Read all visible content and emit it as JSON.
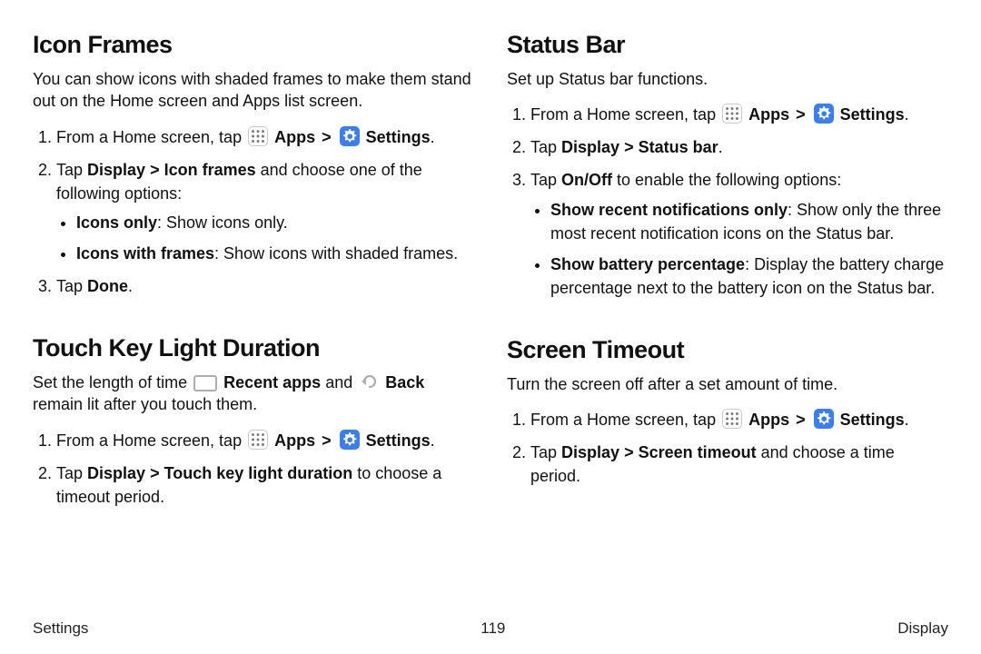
{
  "left": {
    "iconFrames": {
      "heading": "Icon Frames",
      "lead": "You can show icons with shaded frames to make them stand out on the Home screen and Apps list screen.",
      "step1_pre": "From a Home screen, tap ",
      "apps": "Apps",
      "chev": ">",
      "settings": "Settings",
      "step1_post": ".",
      "step2_pre": "Tap ",
      "step2_b1": "Display",
      "step2_mid": " > ",
      "step2_b2": "Icon frames",
      "step2_post": " and choose one of the following options:",
      "opt1_b": "Icons only",
      "opt1_after": ": Show icons only.",
      "opt2_b": "Icons with frames",
      "opt2_after": ": Show icons with shaded frames.",
      "step3_pre": "Tap ",
      "step3_b": "Done",
      "step3_post": "."
    },
    "touchKey": {
      "heading": "Touch Key Light Duration",
      "lead1": "Set the length of time ",
      "recent": "Recent apps",
      "lead2": " and ",
      "back": "Back",
      "lead3": " remain lit after you touch them.",
      "step1_pre": "From a Home screen, tap ",
      "apps": "Apps",
      "chev": ">",
      "settings": "Settings",
      "step1_post": ".",
      "step2_pre": "Tap ",
      "step2_b1": "Display",
      "step2_mid": " > ",
      "step2_b2": "Touch key light duration",
      "step2_post": " to choose a timeout period."
    }
  },
  "right": {
    "statusBar": {
      "heading": "Status Bar",
      "lead": "Set up Status bar functions.",
      "step1_pre": "From a Home screen, tap ",
      "apps": "Apps",
      "chev": ">",
      "settings": "Settings",
      "step1_post": ".",
      "step2_pre": "Tap ",
      "step2_b1": "Display",
      "step2_mid": " > ",
      "step2_b2": "Status bar",
      "step2_post": ".",
      "step3_pre": "Tap ",
      "step3_b": "On/Off",
      "step3_post": " to enable the following options:",
      "opt1_b": "Show recent notifications only",
      "opt1_after": ": Show only the three most recent notification icons on the Status bar.",
      "opt2_b": "Show battery percentage",
      "opt2_after": ": Display the battery charge percentage next to the battery icon on the Status bar."
    },
    "screenTimeout": {
      "heading": "Screen Timeout",
      "lead": "Turn the screen off after a set amount of time.",
      "step1_pre": "From a Home screen, tap ",
      "apps": "Apps",
      "chev": ">",
      "settings": "Settings",
      "step1_post": ".",
      "step2_pre": "Tap ",
      "step2_b1": "Display",
      "step2_mid": " > ",
      "step2_b2": "Screen timeout",
      "step2_post": " and choose a time period."
    }
  },
  "footer": {
    "left": "Settings",
    "center": "119",
    "right": "Display"
  }
}
